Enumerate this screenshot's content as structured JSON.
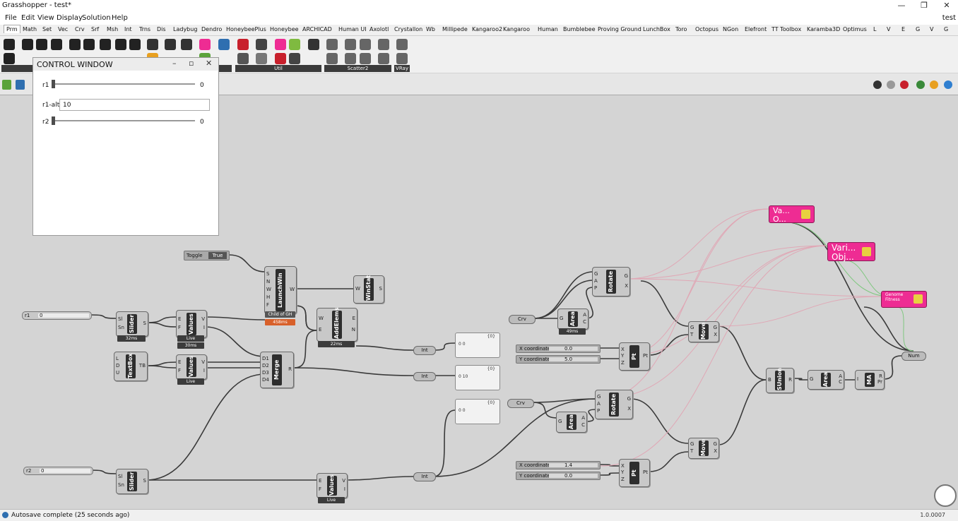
{
  "window": {
    "title": "Grasshopper - test*",
    "doc_name": "test",
    "minimize": "—",
    "restore": "❐",
    "close": "✕"
  },
  "menu": [
    "File",
    "Edit",
    "View",
    "Display",
    "Solution",
    "Help"
  ],
  "tabs": [
    "Prm",
    "Math",
    "Set",
    "Vec",
    "Crv",
    "Srf",
    "Msh",
    "Int",
    "Trns",
    "Dis",
    "Ladybug",
    "Dendro",
    "HoneybeePlus",
    "Honeybee",
    "ARCHICAD",
    "Human UI",
    "Axolotl",
    "Crystallon",
    "Wb",
    "Millipede",
    "Kangaroo2",
    "Kangaroo",
    "Human",
    "Bumblebee",
    "Proving Ground",
    "LunchBox",
    "Toro",
    "Octopus",
    "NGon",
    "Elefront",
    "TT Toolbox",
    "Karamba3D",
    "Optimus",
    "L",
    "V",
    "E",
    "G",
    "V",
    "G"
  ],
  "ribbon_groups": [
    "Util",
    "Scatter2",
    "VRay"
  ],
  "control_window": {
    "title": "CONTROL WINDOW",
    "r1_label": "r1",
    "r1_value": "0",
    "r1alt_label": "r1-alt",
    "r1alt_value": "10",
    "r2_label": "r2",
    "r2_value": "0"
  },
  "canvas": {
    "toggle": {
      "label": "Toggle",
      "value": "True"
    },
    "slider_r1": {
      "label": "r1",
      "value": "0"
    },
    "slider_r2": {
      "label": "r2",
      "value": "0"
    },
    "launchwin": {
      "name": "LaunchWin",
      "inputs": [
        "S",
        "N",
        "W",
        "H",
        "F"
      ],
      "output": "W",
      "child_label": "Child of GH",
      "time": "458ms"
    },
    "winstat": {
      "name": "WinStat",
      "input": "W",
      "output": "S"
    },
    "addelems": {
      "name": "AddElems",
      "inputs": [
        "W",
        "E"
      ],
      "outputs": [
        "E",
        "N"
      ],
      "time": "22ms"
    },
    "slider1": {
      "name": "Slider",
      "inputs": [
        "Sl",
        "Sn"
      ],
      "output": "S",
      "time": "32ms"
    },
    "values1": {
      "name": "Values",
      "inputs": [
        "E",
        "F"
      ],
      "outputs": [
        "V",
        "I"
      ],
      "state": "Live",
      "time": "30ms"
    },
    "textbox": {
      "name": "TextBox",
      "inputs": [
        "L",
        "D",
        "U"
      ],
      "output": "TB"
    },
    "values2": {
      "name": "Values",
      "inputs": [
        "E",
        "F"
      ],
      "outputs": [
        "V",
        "I"
      ],
      "state": "Live"
    },
    "merge": {
      "name": "Merge",
      "inputs": [
        "D1",
        "D2",
        "D3",
        "D4"
      ],
      "output": "R"
    },
    "slider2": {
      "name": "Slider",
      "inputs": [
        "Sl",
        "Sn"
      ],
      "output": "S"
    },
    "values3": {
      "name": "Values",
      "inputs": [
        "E",
        "F"
      ],
      "outputs": [
        "V",
        "I"
      ],
      "state": "Live"
    },
    "int1": "Int",
    "int2": "Int",
    "int3": "Int",
    "panel1": {
      "header": "{0}",
      "value": "0 0"
    },
    "panel2": {
      "header": "{0}",
      "value": "0 10"
    },
    "panel3": {
      "header": "{0}",
      "value": "0 0"
    },
    "crv1": "Crv",
    "crv2": "Crv",
    "area1": {
      "name": "Area",
      "input": "G",
      "outputs": [
        "A",
        "C"
      ],
      "time": "49ms"
    },
    "area2": {
      "name": "Area",
      "input": "G",
      "outputs": [
        "A",
        "C"
      ]
    },
    "rotate1": {
      "name": "Rotate",
      "inputs": [
        "G",
        "A",
        "P"
      ],
      "outputs": [
        "G",
        "X"
      ]
    },
    "rotate2": {
      "name": "Rotate",
      "inputs": [
        "G",
        "A",
        "P"
      ],
      "outputs": [
        "G",
        "X"
      ]
    },
    "pt1": {
      "name": "Pt",
      "inputs": [
        "X",
        "Y",
        "Z"
      ],
      "output": "Pt",
      "x_label": "X coordinate",
      "x_value": "0.0",
      "y_label": "Y coordinate",
      "y_value": "5.0"
    },
    "pt2": {
      "name": "Pt",
      "inputs": [
        "X",
        "Y",
        "Z"
      ],
      "output": "Pt",
      "x_label": "X coordinate",
      "x_value": "1.4",
      "y_label": "Y coordinate",
      "y_value": "0.0"
    },
    "move1": {
      "name": "Move",
      "inputs": [
        "G",
        "T"
      ],
      "outputs": [
        "G",
        "X"
      ]
    },
    "move2": {
      "name": "Move",
      "inputs": [
        "G",
        "T"
      ],
      "outputs": [
        "G",
        "X"
      ]
    },
    "sunion": {
      "name": "SUnion",
      "input": "B",
      "output": "R"
    },
    "area3": {
      "name": "Area",
      "input": "G",
      "outputs": [
        "A",
        "C"
      ]
    },
    "ma": {
      "name": "MA",
      "input": "I",
      "outputs": [
        "R",
        "Pr"
      ]
    },
    "num": "Num",
    "galapagos1": {
      "line1": "Va...",
      "line2": "O..."
    },
    "galapagos2": {
      "line1": "Vari...",
      "line2": "Obj..."
    },
    "genome": {
      "line1": "Genome",
      "line2": "Fitness"
    }
  },
  "status": {
    "text": "Autosave complete (25 seconds ago)",
    "version": "1.0.0007"
  }
}
